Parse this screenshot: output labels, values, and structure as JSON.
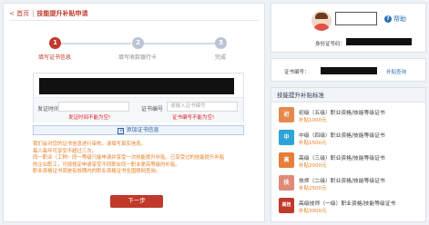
{
  "breadcrumb": {
    "home": "< 首页",
    "separator": "|",
    "current": "技能提升补贴申请"
  },
  "steps": [
    {
      "number": "1",
      "label": "填写证书信息"
    },
    {
      "number": "2",
      "label": "填写收款银行卡"
    },
    {
      "number": "3",
      "label": "完成"
    }
  ],
  "form": {
    "issue_date_label": "发证时间",
    "cert_no_label": "证书编号",
    "cert_no_placeholder": "请输入证书编号",
    "date_error": "发证时间不能为空!",
    "cert_error": "证书编号不能为空!",
    "add_cert_label": "添加证书信息",
    "add_icon": "+"
  },
  "notes": [
    "我们会对您的证书信息进行审核，请填写真实信息。",
    "每人每年可享受不超过三次。",
    "同一职业（工种）同一等级只能申请并享受一次技能提升补贴，已享受过的技能提升补贴",
    "的企业职工，可按规定申请享受不同职业同一职业更高等级的补贴。",
    "职业资格证书须是有效期内的职业资格证书全国联网查询。"
  ],
  "next_button": "下一步",
  "profile": {
    "help_label": "帮助",
    "help_icon": "?",
    "id_label": "身份证号码："
  },
  "cert_query": {
    "label": "证书编号：",
    "link": "补贴查询"
  },
  "standards": {
    "title": "技能提升补贴标准",
    "levels": [
      {
        "badge": "初",
        "color": "#e6894b",
        "name": "初级（五级）职业资格/技能等级证书",
        "amount": "补贴1000元"
      },
      {
        "badge": "中",
        "color": "#2ea3d8",
        "name": "中级（四级）职业资格/技能等级证书",
        "amount": "补贴1500元"
      },
      {
        "badge": "高",
        "color": "#e67e3a",
        "name": "高级（三级）职业资格/技能等级证书",
        "amount": "补贴2000元"
      },
      {
        "badge": "技",
        "color": "#e08a7a",
        "name": "技师（二级）职业资格/技能等级证书",
        "amount": "补贴2500元"
      },
      {
        "badge": "高技",
        "color": "#c0392b",
        "name": "高级技师（一级）职业资格/技能等级证书",
        "amount": "补贴3000元"
      }
    ]
  }
}
